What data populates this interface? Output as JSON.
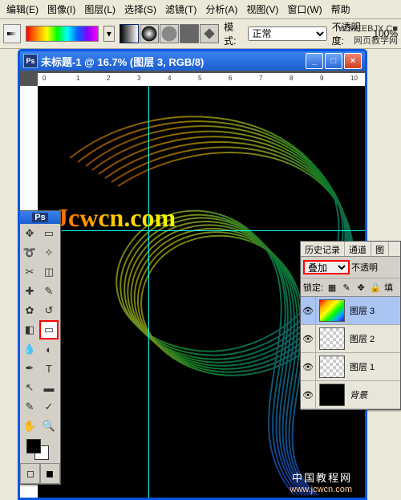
{
  "menu": {
    "edit": "编辑(E)",
    "image": "图像(I)",
    "layer": "图层(L)",
    "select": "选择(S)",
    "filter": "滤镜(T)",
    "analysis": "分析(A)",
    "view": "视图(V)",
    "window": "窗口(W)",
    "help": "帮助"
  },
  "options": {
    "mode_label": "模式:",
    "mode_value": "正常",
    "opacity_label": "不透明度:",
    "opacity_value": "100%",
    "site": "网页教学网"
  },
  "document": {
    "title": "未标题-1 @ 16.7% (图层 3, RGB/8)",
    "min": "_",
    "max": "□",
    "close": "×",
    "ruler_marks": [
      "0",
      "1",
      "2",
      "3",
      "4",
      "5",
      "6",
      "7",
      "8",
      "9",
      "10"
    ],
    "watermark": "Jcwcn.com",
    "footer1": "中国教程网",
    "footer2": "www.jcwcn.com"
  },
  "toolbox": {
    "ps": "Ps"
  },
  "layers_panel": {
    "tabs": [
      "历史记录",
      "通道",
      "图"
    ],
    "blend": "叠加",
    "opacity_label": "不透明",
    "lock_label": "锁定:",
    "fill_label": "填",
    "layers": [
      {
        "name": "图层 3",
        "thumb": "rainbow",
        "sel": true
      },
      {
        "name": "图层 2",
        "thumb": "trans",
        "sel": false
      },
      {
        "name": "图层 1",
        "thumb": "trans",
        "sel": false
      },
      {
        "name": "背景",
        "thumb": "black",
        "sel": false,
        "italic": true
      }
    ]
  },
  "corner": {
    "a": "W.MEEBJX.C■",
    "b": "网页教学网"
  }
}
